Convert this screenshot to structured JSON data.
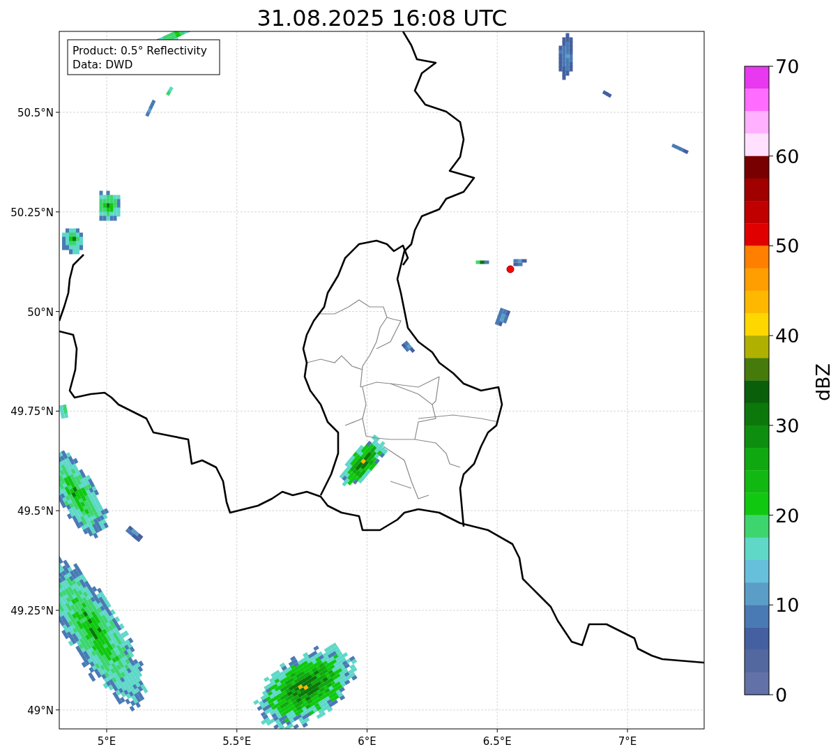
{
  "title": "31.08.2025 16:08 UTC",
  "legend": [
    "Product: 0.5° Reflectivity",
    "Data: DWD"
  ],
  "map": {
    "lat_ticks": [
      "50.5°N",
      "50.25°N",
      "50°N",
      "49.75°N",
      "49.5°N",
      "49.25°N",
      "49°N"
    ],
    "lon_ticks": [
      "5°E",
      "5.5°E",
      "6°E",
      "6.5°E",
      "7°E"
    ]
  },
  "colorbar": {
    "label": "dBZ",
    "ticks": [
      "70",
      "60",
      "50",
      "40",
      "30",
      "20",
      "10",
      "0"
    ],
    "bands": [
      {
        "color": "#e838f0"
      },
      {
        "color": "#ff6cff"
      },
      {
        "color": "#ffb0ff"
      },
      {
        "color": "#ffe0ff"
      },
      {
        "color": "#780000"
      },
      {
        "color": "#a00000"
      },
      {
        "color": "#c00000"
      },
      {
        "color": "#e00000"
      },
      {
        "color": "#ff7f00"
      },
      {
        "color": "#ff9e00"
      },
      {
        "color": "#ffb800"
      },
      {
        "color": "#ffd700"
      },
      {
        "color": "#b0b000"
      },
      {
        "color": "#467a0a"
      },
      {
        "color": "#0a600a"
      },
      {
        "color": "#0c780c"
      },
      {
        "color": "#0e8e0e"
      },
      {
        "color": "#10a810"
      },
      {
        "color": "#12b812"
      },
      {
        "color": "#10c810"
      },
      {
        "color": "#3dd66e"
      },
      {
        "color": "#5fd8c8"
      },
      {
        "color": "#66c0dc"
      },
      {
        "color": "#5a9ec8"
      },
      {
        "color": "#4a7ab4"
      },
      {
        "color": "#4460a0"
      },
      {
        "color": "#5468a0"
      },
      {
        "color": "#6272a8"
      }
    ]
  }
}
